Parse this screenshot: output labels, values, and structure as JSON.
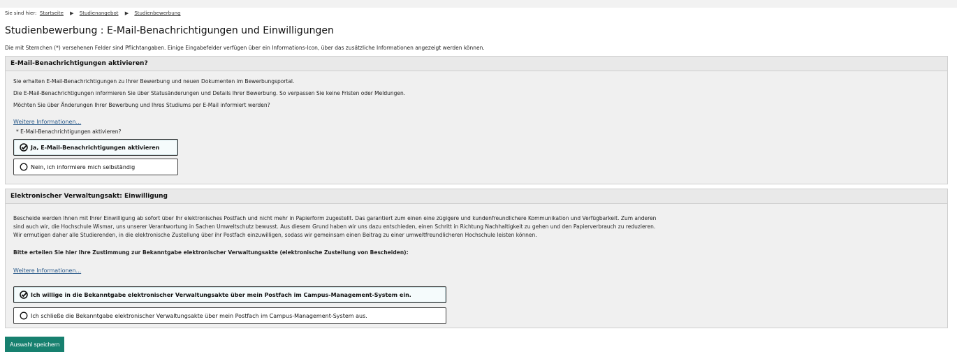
{
  "breadcrumb": {
    "prefix": "Sie sind hier:",
    "items": [
      "Startseite",
      "Studienangebot",
      "Studienbewerbung"
    ],
    "separator_icon": "triangle-right-icon"
  },
  "page_title": "Studienbewerbung : E-Mail-Benachrichtigungen und Einwilligungen",
  "required_note": "Die mit Sternchen (*) versehenen Felder sind Pflichtangaben. Einige Eingabefelder verfügen über ein Informations-Icon, über das zusätzliche Informationen angezeigt werden können.",
  "email_section": {
    "header": "E-Mail-Benachrichtigungen aktivieren?",
    "paragraphs": [
      "Sie erhalten E-Mail-Benachrichtigungen zu Ihrer Bewerbung und neuen Dokumenten im Bewerbungsportal.",
      "Die E-Mail-Benachrichtigungen informieren Sie über Statusänderungen und Details Ihrer Bewerbung. So verpassen Sie keine Fristen oder Meldungen.",
      "Möchten Sie über Änderungen Ihrer Bewerbung und Ihres Studiums per E-Mail informiert werden?"
    ],
    "more_link": "Weitere Informationen...",
    "field_label": "* E-Mail-Benachrichtigungen aktivieren?",
    "options": [
      {
        "label": "Ja, E-Mail-Benachrichtigungen aktivieren",
        "selected": true,
        "icon": "check-circle-icon"
      },
      {
        "label": "Nein, ich informiere mich selbständig",
        "selected": false,
        "icon": "circle-icon"
      }
    ]
  },
  "consent_section": {
    "header": "Elektronischer Verwaltungsakt: Einwilligung",
    "paragraphs": [
      "Bescheide werden Ihnen mit Ihrer Einwilligung ab sofort über Ihr elektronisches Postfach und nicht mehr in Papierform zugestellt. Das garantiert zum einen eine zügigere und kundenfreundlichere Kommunikation und Verfügbarkeit. Zum anderen",
      "sind auch wir, die Hochschule Wismar, uns unserer Verantwortung in Sachen Umweltschutz bewusst. Aus diesem Grund haben wir uns dazu entschieden, einen Schritt in Richtung Nachhaltigkeit zu gehen und den Papierverbrauch zu reduzieren.",
      "Wir ermutigen daher alle Studierenden, in die elektronische Zustellung über ihr Postfach einzuwilligen, sodass wir gemeinsam einen Beitrag zu einer umweltfreundlicheren Hochschule leisten können."
    ],
    "prompt": "Bitte erteilen Sie hier Ihre Zustimmung zur Bekanntgabe elektronischer Verwaltungsakte (elektronische Zustellung von Bescheiden):",
    "more_link": "Weitere Informationen...",
    "options": [
      {
        "label": "Ich willige in die Bekanntgabe elektronischer Verwaltungsakte über mein Postfach im Campus-Management-System ein.",
        "selected": true,
        "icon": "check-circle-icon"
      },
      {
        "label": "Ich schließe die Bekanntgabe elektronischer Verwaltungsakte über mein Postfach im Campus-Management-System aus.",
        "selected": false,
        "icon": "circle-icon"
      }
    ]
  },
  "save_button": "Auswahl speichern",
  "colors": {
    "accent": "#17806f",
    "link": "#2a5a8a",
    "panel": "#f0f0f0"
  }
}
